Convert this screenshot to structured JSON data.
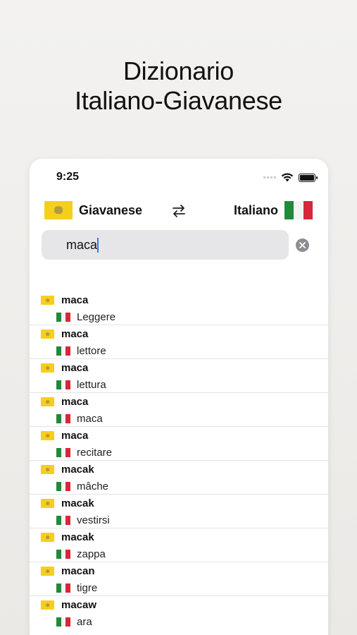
{
  "headline": {
    "line1": "Dizionario",
    "line2": "Italiano-Giavanese"
  },
  "status_bar": {
    "time": "9:25"
  },
  "languages": {
    "source": "Giavanese",
    "target": "Italiano"
  },
  "search": {
    "value": "maca"
  },
  "icons": {
    "swap": "swap-arrows-icon",
    "clear": "clear-circle-icon",
    "wifi": "wifi-icon",
    "battery": "battery-icon",
    "signal": "cellular-signal-icon"
  },
  "colors": {
    "javanese_flag": "#f5cf1a",
    "italian_green": "#1f8a3a",
    "italian_red": "#d6283a",
    "caret": "#2f7bf6"
  },
  "results": [
    {
      "word": "maca",
      "translation": "Leggere"
    },
    {
      "word": "maca",
      "translation": "lettore"
    },
    {
      "word": "maca",
      "translation": "lettura"
    },
    {
      "word": "maca",
      "translation": "maca"
    },
    {
      "word": "maca",
      "translation": "recitare"
    },
    {
      "word": "macak",
      "translation": "mâche"
    },
    {
      "word": "macak",
      "translation": "vestirsi"
    },
    {
      "word": "macak",
      "translation": "zappa"
    },
    {
      "word": "macan",
      "translation": "tigre"
    },
    {
      "word": "macaw",
      "translation": "ara"
    }
  ]
}
